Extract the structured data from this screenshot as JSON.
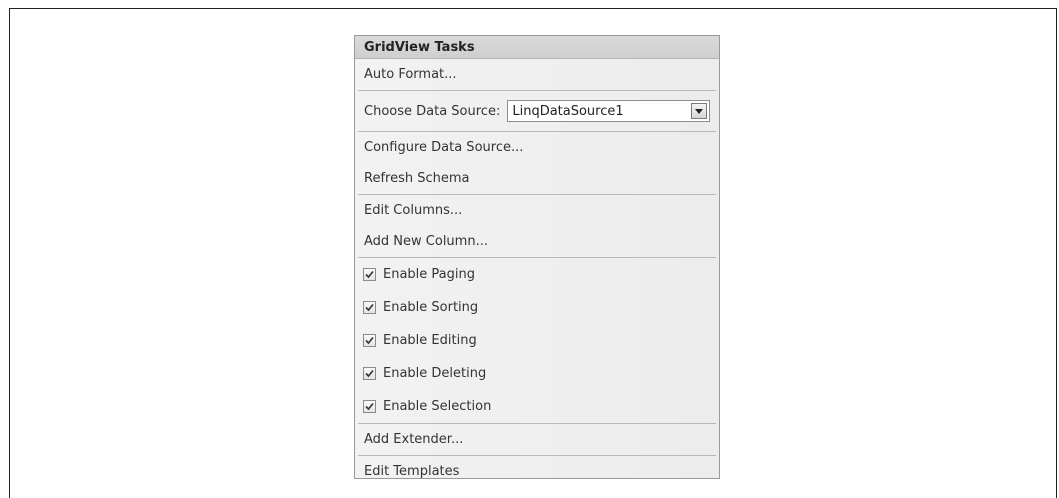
{
  "panel": {
    "title": "GridView Tasks",
    "auto_format": "Auto Format...",
    "choose_data_source_label": "Choose Data Source:",
    "data_source_value": "LinqDataSource1",
    "configure_data_source": "Configure Data Source...",
    "refresh_schema": "Refresh Schema",
    "edit_columns": "Edit Columns...",
    "add_new_column": "Add New Column...",
    "checkboxes": [
      {
        "label": "Enable Paging",
        "checked": true
      },
      {
        "label": "Enable Sorting",
        "checked": true
      },
      {
        "label": "Enable Editing",
        "checked": true
      },
      {
        "label": "Enable Deleting",
        "checked": true
      },
      {
        "label": "Enable Selection",
        "checked": true
      }
    ],
    "add_extender": "Add Extender...",
    "edit_templates": "Edit Templates"
  },
  "icons": {
    "dropdown": "chevron-down-icon",
    "check": "checkmark-icon"
  }
}
